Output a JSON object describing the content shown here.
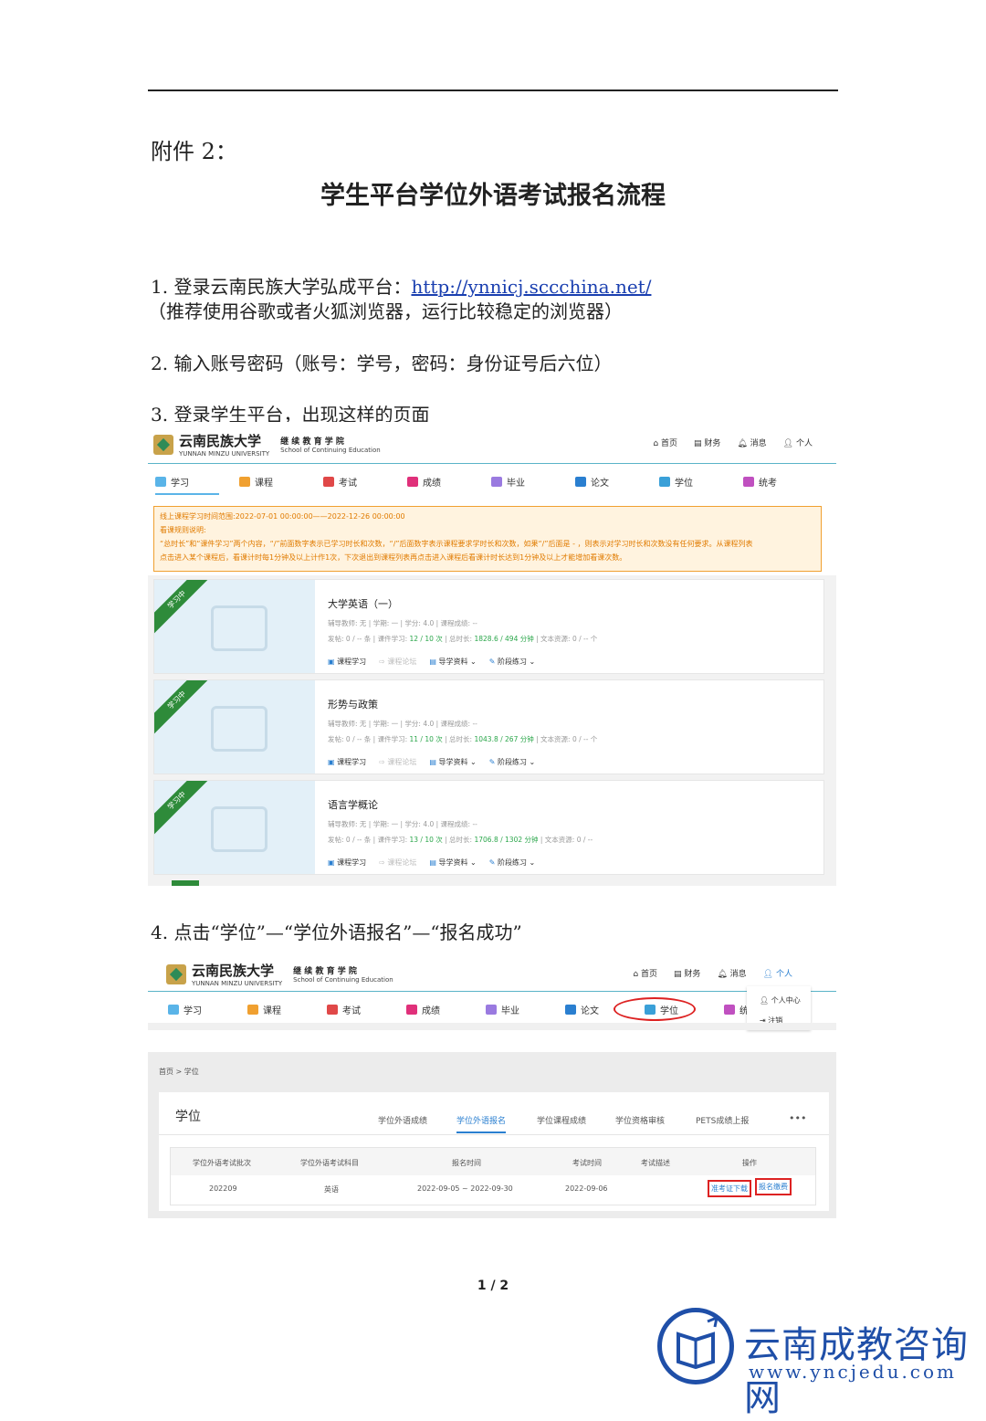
{
  "attachment": "附件 2：",
  "title": "学生平台学位外语考试报名流程",
  "steps": {
    "s1_prefix": "1.  登录云南民族大学弘成平台：",
    "s1_link": "http://ynnicj.sccchina.net/",
    "s1_note": "（推荐使用谷歌或者火狐浏览器，运行比较稳定的浏览器）",
    "s2": "2.  输入账号密码（账号：学号，密码：身份证号后六位）",
    "s3": "3.  登录学生平台，出现这样的页面",
    "s4": "4.  点击“学位”—“学位外语报名”—“报名成功”"
  },
  "header": {
    "logo_cn": "云南民族大学",
    "logo_en": "YUNNAN MINZU UNIVERSITY",
    "school_cn": "继 续 教 育 学 院",
    "school_en": "School of Continuing Education",
    "nav": [
      "首页",
      "财务",
      "消息",
      "个人"
    ]
  },
  "tabs": [
    "学习",
    "课程",
    "考试",
    "成绩",
    "毕业",
    "论文",
    "学位",
    "统考"
  ],
  "tab_colors": [
    "#5ab4e8",
    "#f0a030",
    "#e04848",
    "#e0307a",
    "#9a7ae0",
    "#2a7fd0",
    "#3aa0d8",
    "#c050c0"
  ],
  "notice": [
    "线上课程学习时间范围:2022-07-01 00:00:00——2022-12-26 00:00:00",
    "看课规则说明:",
    "“总时长”和“课件学习”两个内容，“/”前面数字表示已学习时长和次数，“/”后面数字表示课程要求学时长和次数，如果“/”后面是 - ，则表示对学习时长和次数没有任何要求。从课程列表",
    "点击进入某个课程后，看课计时每1分钟及以上计作1次，下次退出到课程列表再点击进入课程后看课计时长达到1分钟及以上才能增加看课次数。"
  ],
  "courses": [
    {
      "ribbon": "学习中",
      "name": "大学英语（一）",
      "info": "辅导教师: 无  |  学期: 一  |  学分: 4.0  |  课程成绩: --",
      "posts": "发帖: 0 / -- 条  |  课件学习: ",
      "study": "12 / 10 次",
      "dur_label": "  |  总时长: ",
      "dur": "1828.6 / 494 分钟",
      "res": "  |  文本资源: 0 / -- 个"
    },
    {
      "ribbon": "学习中",
      "name": "形势与政策",
      "info": "辅导教师: 无  |  学期: 一  |  学分: 4.0  |  课程成绩: --",
      "posts": "发帖: 0 / -- 条  |  课件学习: ",
      "study": "11 / 10 次",
      "dur_label": "  |  总时长: ",
      "dur": "1043.8 / 267 分钟",
      "res": "  |  文本资源: 0 / -- 个"
    },
    {
      "ribbon": "学习中",
      "name": "语言学概论",
      "info": "辅导教师: 无  |  学期: 一  |  学分: 4.0  |  课程成绩: --",
      "posts": "发帖: 0 / -- 条  |  课件学习: ",
      "study": "13 / 10 次",
      "dur_label": "  |  总时长: ",
      "dur": "1706.8 / 1302 分钟",
      "res": "  |  文本资源: 0 / --"
    }
  ],
  "course_links": [
    "课程学习",
    "课程论坛",
    "导学资料",
    "阶段练习"
  ],
  "dropdown": [
    "个人中心",
    "注销"
  ],
  "degree": {
    "breadcrumb": "首页 > 学位",
    "heading": "学位",
    "tabs": [
      "学位外语成绩",
      "学位外语报名",
      "学位课程成绩",
      "学位资格审核",
      "PETS成绩上报"
    ],
    "more": "•••",
    "columns": [
      "学位外语考试批次",
      "学位外语考试科目",
      "报名时间",
      "考试时间",
      "考试描述",
      "操作"
    ],
    "row": [
      "202209",
      "英语",
      "2022-09-05 ~ 2022-09-30",
      "2022-09-06",
      ""
    ],
    "actions": [
      "准考证下载",
      "报名缴费"
    ]
  },
  "page_number": "1 / 2",
  "watermark": {
    "cn": "云南成教咨询网",
    "url": "www.yncjedu.com"
  }
}
